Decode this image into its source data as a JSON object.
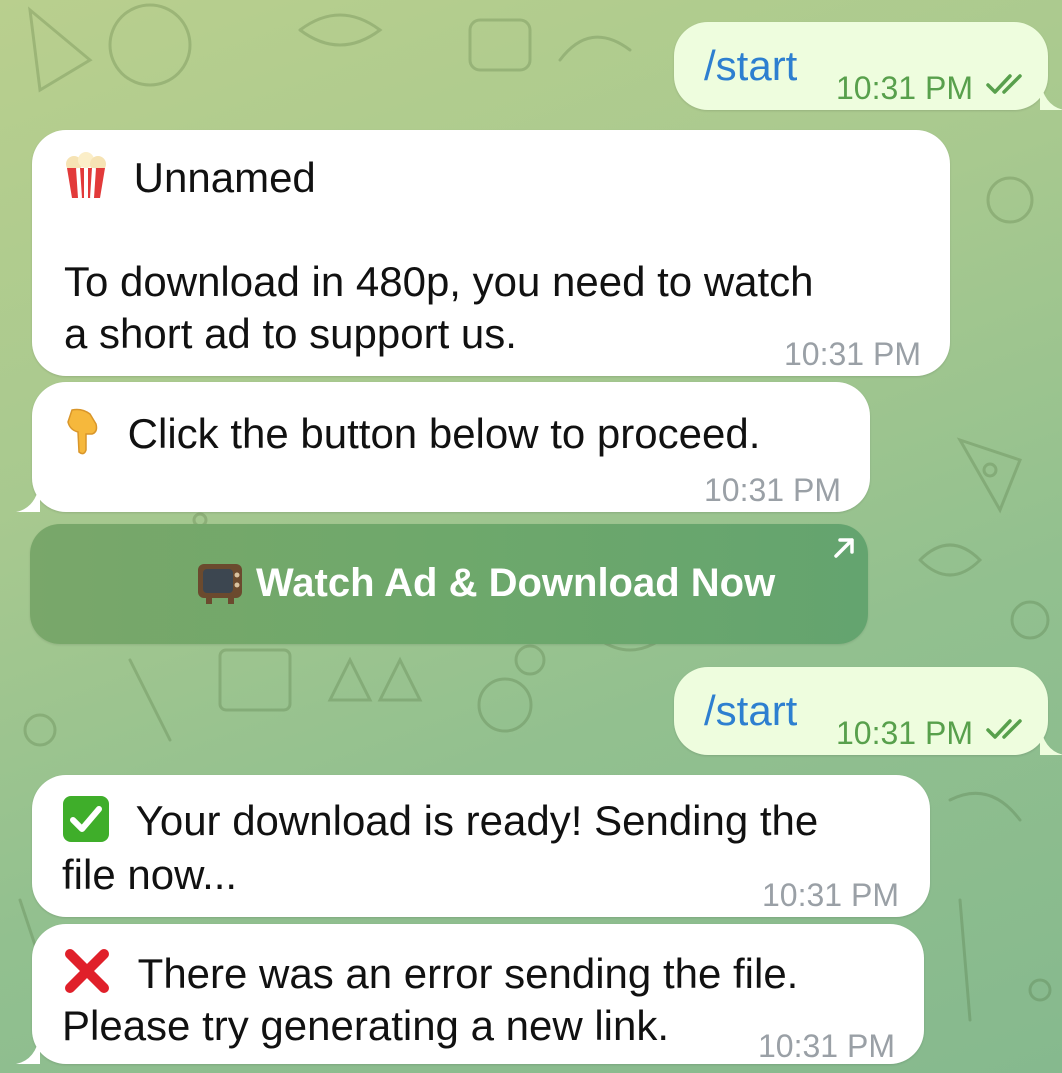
{
  "messages": {
    "out1": {
      "text": "/start",
      "time": "10:31 PM",
      "status_icon": "double-check-icon"
    },
    "in1": {
      "title_emoji": "popcorn-icon",
      "title": "Unnamed",
      "line1": "To download in 480p, you need to watch",
      "line2": "a short ad to support us.",
      "time": "10:31 PM"
    },
    "in2": {
      "emoji": "pointing-down-hand-icon",
      "text": "Click the button below to proceed.",
      "time": "10:31 PM"
    },
    "button": {
      "emoji": "television-icon",
      "label": "Watch Ad & Download Now",
      "arrow_icon": "external-arrow-icon"
    },
    "out2": {
      "text": "/start",
      "time": "10:31 PM",
      "status_icon": "double-check-icon"
    },
    "in3": {
      "emoji": "check-mark-button-icon",
      "line1": "Your download is ready! Sending the",
      "line2": "file now...",
      "time": "10:31 PM"
    },
    "in4": {
      "emoji": "cross-mark-icon",
      "line1": "There was an error sending the file.",
      "line2": "Please try generating a new link.",
      "time": "10:31 PM"
    }
  },
  "colors": {
    "outgoing_bubble": "#eefdde",
    "incoming_bubble": "#ffffff",
    "command_link": "#2d7fd0",
    "outgoing_time": "#58a04c",
    "incoming_time": "#9aa0a6",
    "button": "#6ea86b"
  }
}
